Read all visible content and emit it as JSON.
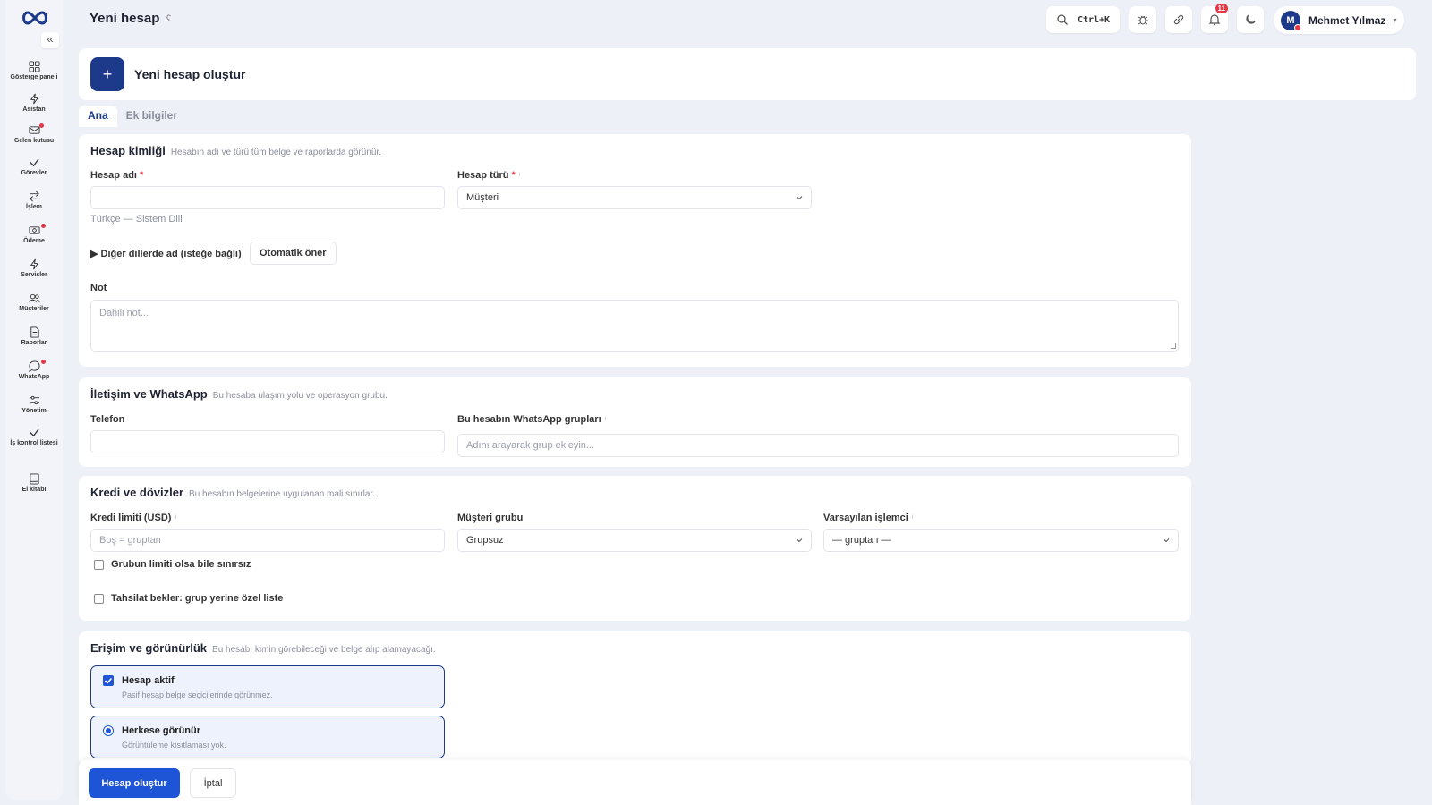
{
  "app": {
    "page_title": "Yeni hesap",
    "title_info": "ʕ"
  },
  "sidebar": {
    "collapse": "«",
    "items": [
      {
        "label": "Gösterge paneli",
        "icon": "dashboard-icon"
      },
      {
        "label": "Asistan",
        "icon": "bolt-icon"
      },
      {
        "label": "Gelen kutusu",
        "icon": "inbox-icon"
      },
      {
        "label": "Görevler",
        "icon": "check-icon"
      },
      {
        "label": "İşlem",
        "icon": "transfer-icon"
      },
      {
        "label": "Ödeme",
        "icon": "payment-icon"
      },
      {
        "label": "Servisler",
        "icon": "bolt-icon"
      },
      {
        "label": "Müşteriler",
        "icon": "users-icon"
      },
      {
        "label": "Raporlar",
        "icon": "report-icon"
      },
      {
        "label": "WhatsApp",
        "icon": "chat-icon"
      },
      {
        "label": "Yönetim",
        "icon": "sliders-icon"
      },
      {
        "label": "İş kontrol listesi",
        "icon": "check-icon"
      },
      {
        "label": "El kitabı",
        "icon": "book-icon"
      }
    ]
  },
  "topbar": {
    "search_shortcut": "Ctrl+K",
    "notif_count": "11",
    "user_initial": "M",
    "user_name": "Mehmet Yılmaz",
    "user_caret": "▾"
  },
  "header": {
    "plus": "+",
    "title": "Yeni hesap oluştur"
  },
  "tabs": [
    {
      "label": "Ana"
    },
    {
      "label": "Ek bilgiler"
    }
  ],
  "identity": {
    "title": "Hesap kimliği",
    "desc": "Hesabın adı ve türü tüm belge ve raporlarda görünür.",
    "name_label": "Hesap adı",
    "required": "*",
    "name_hint": "Türkçe — Sistem Dili",
    "type_label": "Hesap türü",
    "type_info": "ⁱ",
    "type_value": "Müşteri",
    "other_langs": "▶ Diğer dillerde ad (isteğe bağlı)",
    "auto_suggest": "Otomatik öner",
    "note_label": "Not",
    "note_placeholder": "Dahili not..."
  },
  "contact": {
    "title": "İletişim ve WhatsApp",
    "desc": "Bu hesaba ulaşım yolu ve operasyon grubu.",
    "phone_label": "Telefon",
    "wa_label": "Bu hesabın WhatsApp grupları",
    "wa_info": "ⁱ",
    "wa_placeholder": "Adını arayarak grup ekleyin..."
  },
  "credit": {
    "title": "Kredi ve dövizler",
    "desc": "Bu hesabın belgelerine uygulanan mali sınırlar.",
    "limit_label": "Kredi limiti (USD)",
    "limit_info": "ⁱ",
    "limit_placeholder": "Boş = gruptan",
    "group_label": "Müşteri grubu",
    "group_value": "Grupsuz",
    "processor_label": "Varsayılan işlemci",
    "processor_info": "ⁱ",
    "processor_value": "— gruptan —",
    "unlimited": "Grubun limiti olsa bile sınırsız",
    "collection": "Tahsilat bekler: grup yerine özel liste"
  },
  "access": {
    "title": "Erişim ve görünürlük",
    "desc": "Bu hesabı kimin görebileceği ve belge alıp alamayacağı.",
    "active_title": "Hesap aktif",
    "active_sub": "Pasif hesap belge seçicilerinde görünmez.",
    "visible_title": "Herkese görünür",
    "visible_sub": "Görüntüleme kısıtlaması yok."
  },
  "footer": {
    "create": "Hesap oluştur",
    "cancel": "İptal"
  }
}
